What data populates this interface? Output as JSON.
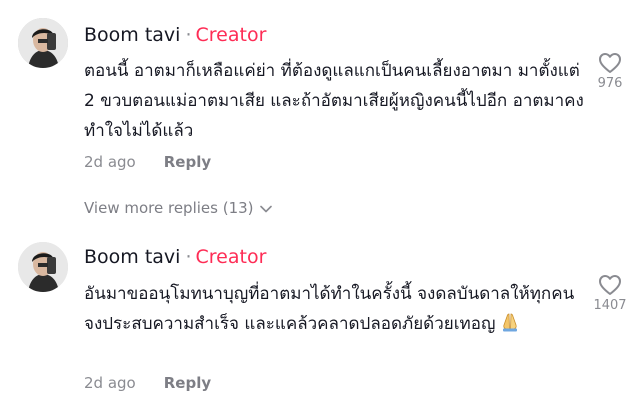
{
  "comments": [
    {
      "author": "Boom tavi",
      "separator": "·",
      "badge": "Creator",
      "text": "ตอนนี้ อาตมาก็เหลือแค่ย่า ที่ต้องดูแลแกเป็นคนเลี้ยงอาตมา มาตั้งแต่ 2 ขวบตอนแม่อาตมาเสีย และถ้าอัตมาเสียผู้หญิงคนนี้ไปอีก อาตมาคงทำใจไม่ได้แล้ว",
      "time": "2d ago",
      "reply_label": "Reply",
      "likes": "976"
    },
    {
      "author": "Boom tavi",
      "separator": "·",
      "badge": "Creator",
      "text": "อันมาขออนุโมทนาบุญที่อาตมาได้ทำในครั้งนี้ จงดลบันดาลให้ทุกคนจงประสบความสำเร็จ และแคล้วคลาดปลอดภัยด้วยเทอญ",
      "time": "2d ago",
      "reply_label": "Reply",
      "likes": "1407"
    }
  ],
  "view_more": {
    "label": "View more replies (13)"
  },
  "icons": {
    "like": "heart-outline-icon",
    "expand": "chevron-down-icon",
    "emoji": "folded-hands-emoji"
  },
  "colors": {
    "badge": "#fe2c55",
    "text": "#161823",
    "secondary": "#8a8b91"
  }
}
